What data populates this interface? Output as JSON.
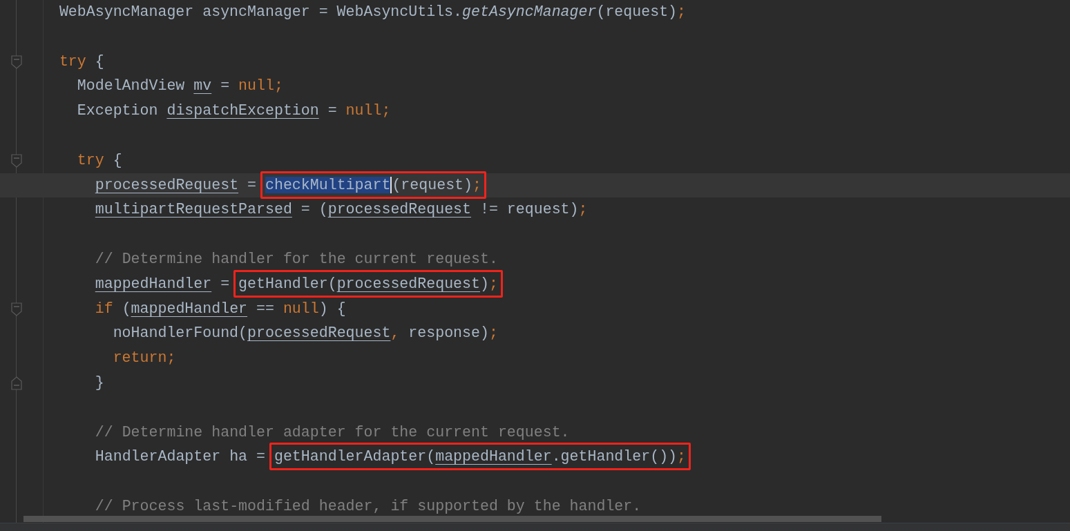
{
  "editor": {
    "lines": [
      {
        "kind": "code",
        "current": false,
        "tokens": [
          {
            "kind": "plain",
            "text": "WebAsyncManager asyncManager = WebAsyncUtils."
          },
          {
            "kind": "static",
            "text": "getAsyncManager"
          },
          {
            "kind": "plain",
            "text": "(request)"
          },
          {
            "kind": "keyword",
            "text": ";"
          }
        ]
      },
      {
        "kind": "blank",
        "current": false
      },
      {
        "kind": "block",
        "current": false,
        "tokens": [
          {
            "kind": "keyword",
            "text": "try"
          },
          {
            "kind": "plain",
            "text": " {"
          }
        ],
        "children": [
          {
            "kind": "code",
            "current": false,
            "tokens": [
              {
                "kind": "plain",
                "text": "ModelAndView "
              },
              {
                "kind": "field",
                "text": "mv"
              },
              {
                "kind": "plain",
                "text": " = "
              },
              {
                "kind": "keyword",
                "text": "null;"
              }
            ]
          },
          {
            "kind": "code",
            "current": false,
            "tokens": [
              {
                "kind": "plain",
                "text": "Exception "
              },
              {
                "kind": "field",
                "text": "dispatchException"
              },
              {
                "kind": "plain",
                "text": " = "
              },
              {
                "kind": "keyword",
                "text": "null;"
              }
            ]
          },
          {
            "kind": "blank",
            "current": false
          },
          {
            "kind": "block",
            "current": false,
            "tokens": [
              {
                "kind": "keyword",
                "text": "try"
              },
              {
                "kind": "plain",
                "text": " {"
              }
            ],
            "children": [
              {
                "kind": "code",
                "current": true,
                "tokens": [
                  {
                    "kind": "field",
                    "text": "processedRequest"
                  },
                  {
                    "kind": "plain",
                    "text": " = "
                  }
                ],
                "boxed": [
                  {
                    "kind": "selected",
                    "text": "checkMultipart"
                  },
                  {
                    "kind": "plain",
                    "text": "(request)"
                  },
                  {
                    "kind": "keyword",
                    "text": ";"
                  }
                ]
              },
              {
                "kind": "code",
                "current": false,
                "tokens": [
                  {
                    "kind": "field",
                    "text": "multipartRequestParsed"
                  },
                  {
                    "kind": "plain",
                    "text": " = ("
                  },
                  {
                    "kind": "field",
                    "text": "processedRequest"
                  },
                  {
                    "kind": "plain",
                    "text": " != request)"
                  },
                  {
                    "kind": "keyword",
                    "text": ";"
                  }
                ]
              },
              {
                "kind": "blank",
                "current": false
              },
              {
                "kind": "code",
                "current": false,
                "tokens": [
                  {
                    "kind": "comment",
                    "text": "// Determine handler for the current request."
                  }
                ]
              },
              {
                "kind": "code",
                "current": false,
                "tokens": [
                  {
                    "kind": "field",
                    "text": "mappedHandler"
                  },
                  {
                    "kind": "plain",
                    "text": " = "
                  }
                ],
                "boxed": [
                  {
                    "kind": "plain",
                    "text": "getHandler("
                  },
                  {
                    "kind": "field",
                    "text": "processedRequest"
                  },
                  {
                    "kind": "plain",
                    "text": ")"
                  },
                  {
                    "kind": "keyword",
                    "text": ";"
                  }
                ]
              },
              {
                "kind": "block",
                "current": false,
                "tokens": [
                  {
                    "kind": "keyword",
                    "text": "if"
                  },
                  {
                    "kind": "plain",
                    "text": " ("
                  },
                  {
                    "kind": "field",
                    "text": "mappedHandler"
                  },
                  {
                    "kind": "plain",
                    "text": " == "
                  },
                  {
                    "kind": "keyword",
                    "text": "null"
                  },
                  {
                    "kind": "plain",
                    "text": ") {"
                  }
                ],
                "children": [
                  {
                    "kind": "code",
                    "current": false,
                    "tokens": [
                      {
                        "kind": "plain",
                        "text": "noHandlerFound("
                      },
                      {
                        "kind": "field",
                        "text": "processedRequest"
                      },
                      {
                        "kind": "keyword",
                        "text": ", "
                      },
                      {
                        "kind": "plain",
                        "text": "response)"
                      },
                      {
                        "kind": "keyword",
                        "text": ";"
                      }
                    ]
                  },
                  {
                    "kind": "code",
                    "current": false,
                    "tokens": [
                      {
                        "kind": "keyword",
                        "text": "return;"
                      }
                    ]
                  }
                ]
              },
              {
                "kind": "close",
                "current": false,
                "tokens": [
                  {
                    "kind": "plain",
                    "text": "}"
                  }
                ]
              },
              {
                "kind": "blank",
                "current": false
              },
              {
                "kind": "code",
                "current": false,
                "tokens": [
                  {
                    "kind": "comment",
                    "text": "// Determine handler adapter for the current request."
                  }
                ]
              },
              {
                "kind": "code",
                "current": false,
                "tokens": [
                  {
                    "kind": "plain",
                    "text": "HandlerAdapter ha = "
                  }
                ],
                "boxed": [
                  {
                    "kind": "plain",
                    "text": "getHandlerAdapter("
                  },
                  {
                    "kind": "field",
                    "text": "mappedHandler"
                  },
                  {
                    "kind": "plain",
                    "text": ".getHandler())"
                  },
                  {
                    "kind": "keyword",
                    "text": ";"
                  }
                ]
              },
              {
                "kind": "blank",
                "current": false
              },
              {
                "kind": "code",
                "current": false,
                "tokens": [
                  {
                    "kind": "comment",
                    "text": "// Process last-modified header, if supported by the handler."
                  }
                ]
              }
            ]
          }
        ]
      }
    ]
  }
}
